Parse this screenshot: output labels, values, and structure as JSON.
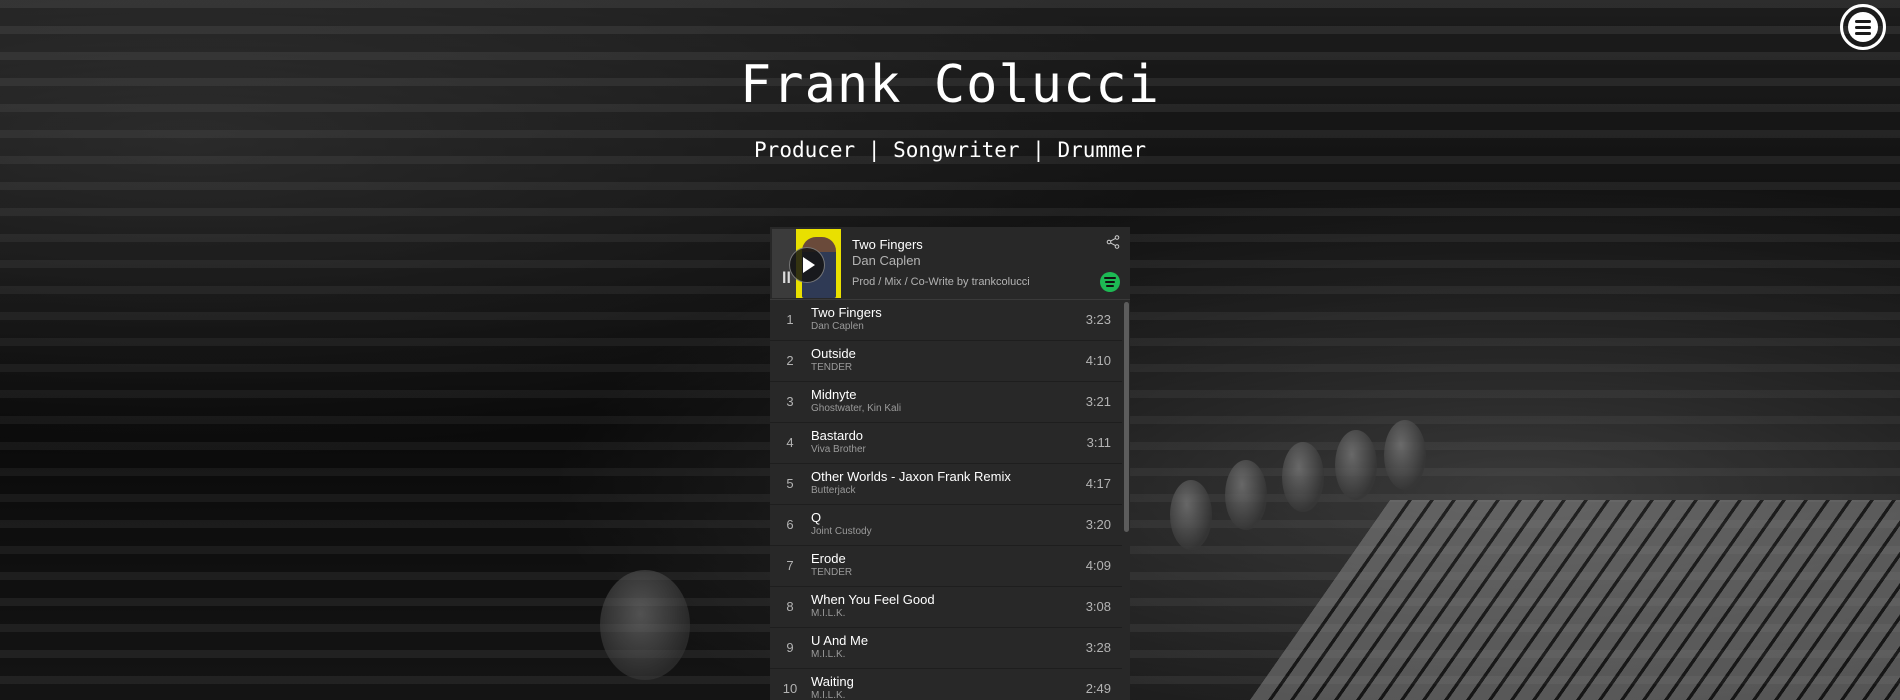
{
  "page": {
    "title": "Frank Colucci",
    "subtitle": "Producer | Songwriter | Drummer",
    "menu_icon": "hamburger-menu-icon"
  },
  "player": {
    "track": "Two Fingers",
    "artist": "Dan Caplen",
    "credit": "Prod / Mix / Co-Write by trankcolucci",
    "icons": {
      "play": "play-icon",
      "share": "share-icon",
      "brand": "spotify-icon"
    },
    "colors": {
      "background": "#282828",
      "spotify_green": "#1db954"
    }
  },
  "tracks": [
    {
      "num": "1",
      "title": "Two Fingers",
      "artist": "Dan Caplen",
      "duration": "3:23"
    },
    {
      "num": "2",
      "title": "Outside",
      "artist": "TENDER",
      "duration": "4:10"
    },
    {
      "num": "3",
      "title": "Midnyte",
      "artist": "Ghostwater, Kin Kali",
      "duration": "3:21"
    },
    {
      "num": "4",
      "title": "Bastardo",
      "artist": "Viva Brother",
      "duration": "3:11"
    },
    {
      "num": "5",
      "title": "Other Worlds - Jaxon Frank Remix",
      "artist": "Butterjack",
      "duration": "4:17"
    },
    {
      "num": "6",
      "title": "Q",
      "artist": "Joint Custody",
      "duration": "3:20"
    },
    {
      "num": "7",
      "title": "Erode",
      "artist": "TENDER",
      "duration": "4:09"
    },
    {
      "num": "8",
      "title": "When You Feel Good",
      "artist": "M.I.L.K.",
      "duration": "3:08"
    },
    {
      "num": "9",
      "title": "U And Me",
      "artist": "M.I.L.K.",
      "duration": "3:28"
    },
    {
      "num": "10",
      "title": "Waiting",
      "artist": "M.I.L.K.",
      "duration": "2:49"
    }
  ]
}
